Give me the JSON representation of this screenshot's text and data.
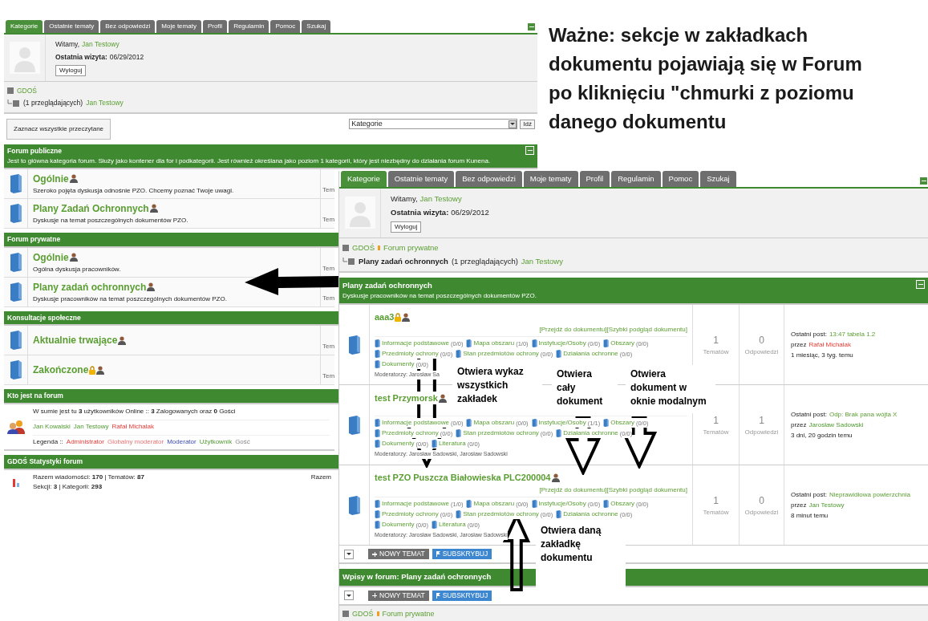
{
  "note": "Ważne: sekcje w zakładkach dokumentu pojawiają się w Forum po kliknięciu \"chmurki z poziomu danego dokumentu",
  "left_forum": {
    "tabs": [
      {
        "label": "Kategorie",
        "selected": true
      },
      {
        "label": "Ostatnie tematy",
        "selected": false
      },
      {
        "label": "Bez odpowiedzi",
        "selected": false
      },
      {
        "label": "Moje tematy",
        "selected": false
      },
      {
        "label": "Profil",
        "selected": false
      },
      {
        "label": "Regulamin",
        "selected": false
      },
      {
        "label": "Pomoc",
        "selected": false
      },
      {
        "label": "Szukaj",
        "selected": false
      }
    ],
    "user": {
      "greeting": "Witamy,",
      "name": "Jan Testowy",
      "last_visit_label": "Ostatnia wizyta:",
      "last_visit": "06/29/2012",
      "logout": "Wyloguj"
    },
    "breadcrumb": {
      "items": [
        "GDOŚ"
      ],
      "viewers": "(1 przeglądających)",
      "viewer_name": "Jan Testowy"
    },
    "mark_read": "Zaznacz wszystkie przeczytane",
    "category_select": {
      "value": "Kategorie"
    },
    "go": "Idź",
    "sections": [
      {
        "title": "Forum publiczne",
        "description": "Jest to główna kategoria forum. Służy jako kontener dla for i podkategorii. Jest również określana jako poziom 1 kategorii, który jest niezbędny do działania forum Kunena.",
        "rows": [
          {
            "title": "Ogólnie",
            "locked": false,
            "description": "Szeroko pojęta dyskusja odnośnie PZO. Chcemy poznać Twoje uwagi.",
            "stat": "Tem"
          },
          {
            "title": "Plany Zadań Ochronnych",
            "locked": false,
            "description": "Dyskusje na temat poszczególnych dokumentów PZO.",
            "stat": "Tem"
          }
        ]
      },
      {
        "title": "Forum prywatne",
        "rows": [
          {
            "title": "Ogólnie",
            "locked": false,
            "description": "Ogólna dyskusja pracowników.",
            "stat": "Tem"
          },
          {
            "title": "Plany zadań ochronnych",
            "locked": false,
            "description": "Dyskusje pracowników na temat poszczególnych dokumentów PZO.",
            "stat": "Tem"
          }
        ]
      },
      {
        "title": "Konsultacje społeczne",
        "rows": [
          {
            "title": "Aktualnie trwające",
            "locked": false,
            "stat": "Tem"
          },
          {
            "title": "Zakończone",
            "locked": true,
            "stat": "Tem"
          }
        ]
      }
    ],
    "who_online": {
      "title": "Kto jest na forum",
      "summary": "W sumie jest tu **3** użytkowników Online :: **3** Zalogowanych oraz **0** Gości",
      "users": [
        {
          "name": "Jan Kowalski",
          "kind": "user"
        },
        {
          "name": "Jan Testowy",
          "kind": "user"
        },
        {
          "name": "Rafał Michalak",
          "kind": "admin"
        }
      ],
      "legend_label": "Legenda ::",
      "legend": [
        {
          "name": "Administrator",
          "kind": "admin"
        },
        {
          "name": "Globalny moderator",
          "kind": "supermod"
        },
        {
          "name": "Moderator",
          "kind": "moderator"
        },
        {
          "name": "Użytkownik",
          "kind": "user"
        },
        {
          "name": "Gość",
          "kind": "guest"
        }
      ]
    },
    "stats": {
      "title": "GDOŚ Statystyki forum",
      "lines": [
        "Razem wiadomości: **170** | Tematów: **87**",
        "Sekcji: **3** | Kategorii: **293**"
      ],
      "side": "Razem"
    }
  },
  "right_forum": {
    "tabs": [
      {
        "label": "Kategorie",
        "selected": true
      },
      {
        "label": "Ostatnie tematy",
        "selected": false
      },
      {
        "label": "Bez odpowiedzi",
        "selected": false
      },
      {
        "label": "Moje tematy",
        "selected": false
      },
      {
        "label": "Profil",
        "selected": false
      },
      {
        "label": "Regulamin",
        "selected": false
      },
      {
        "label": "Pomoc",
        "selected": false
      },
      {
        "label": "Szukaj",
        "selected": false
      }
    ],
    "user": {
      "greeting": "Witamy,",
      "name": "Jan Testowy",
      "last_visit_label": "Ostatnia wizyta:",
      "last_visit": "06/29/2012",
      "logout": "Wyloguj"
    },
    "breadcrumb": {
      "items": [
        "GDOŚ",
        "Forum prywatne"
      ],
      "current": "Plany zadań ochronnych",
      "viewers": "(1 przeglądających)",
      "viewer_name": "Jan Testowy"
    },
    "section": {
      "title": "Plany zadań ochronnych",
      "description": "Dyskusje pracowników na temat poszczególnych dokumentów PZO."
    },
    "rows": [
      {
        "title": "aaa3",
        "locked": true,
        "links": "[Przejdź do dokumentu][Szybki podgląd dokumentu]",
        "tabs": [
          {
            "label": "Informacje podstawowe",
            "count": "(0/0)"
          },
          {
            "label": "Mapa obszaru",
            "count": "(1/0)"
          },
          {
            "label": "Instytucje/Osoby",
            "count": "(0/0)"
          },
          {
            "label": "Obszary",
            "count": "(0/0)"
          },
          {
            "label": "Przedmioty ochrony",
            "count": "(0/0)"
          },
          {
            "label": "Stan przedmiotów ochrony",
            "count": "(0/0)"
          },
          {
            "label": "Działania ochronne",
            "count": "(0/0)"
          },
          {
            "label": "Dokumenty",
            "count": "(0/0)"
          }
        ],
        "moderators": "Moderatorzy: Jarosław Sa",
        "topics": "1",
        "topics_label": "Tematów",
        "replies": "0",
        "replies_label": "Odpowiedzi",
        "last_post_label": "Ostatni post:",
        "last_post": "13:47 tabela 1.2",
        "by_label": "przez",
        "author": {
          "name": "Rafał Michalak",
          "kind": "admin"
        },
        "ago": "1 miesiąc, 3 tyg. temu"
      },
      {
        "title": "test Przymorsk",
        "locked": false,
        "tabs": [
          {
            "label": "Informacje podstawowe",
            "count": "(0/0)"
          },
          {
            "label": "Mapa obszaru",
            "count": "(0/0)"
          },
          {
            "label": "Instytucje/Osoby",
            "count": "(1/1)"
          },
          {
            "label": "Obszary",
            "count": "(0/0)"
          },
          {
            "label": "Przedmioty ochrony",
            "count": "(0/0)"
          },
          {
            "label": "Stan przedmiotów ochrony",
            "count": "(0/0)"
          },
          {
            "label": "Działania ochronne",
            "count": "(0/0)"
          },
          {
            "label": "Dokumenty",
            "count": "(0/0)"
          },
          {
            "label": "Literatura",
            "count": "(0/0)"
          }
        ],
        "moderators": "Moderatorzy: Jarosław Sadowski, Jarosław Sadowski",
        "topics": "1",
        "topics_label": "Tematów",
        "replies": "1",
        "replies_label": "Odpowiedzi",
        "last_post_label": "Ostatni post:",
        "last_post": "Odp: Brak pana wójta X",
        "by_label": "przez",
        "author": {
          "name": "Jarosław Sadowski",
          "kind": "user"
        },
        "ago": "3 dni, 20 godzin temu"
      },
      {
        "title": "test PZO Puszcza Białowieska PLC200004",
        "locked": false,
        "links": "[Przejdź do dokumentu][Szybki podgląd dokumentu]",
        "tabs": [
          {
            "label": "Informacje podstawowe",
            "count": "(1/0)"
          },
          {
            "label": "Mapa obszaru",
            "count": "(0/0)"
          },
          {
            "label": "Instytucje/Osoby",
            "count": "(0/0)"
          },
          {
            "label": "Obszary",
            "count": "(0/0)"
          },
          {
            "label": "Przedmioty ochrony",
            "count": "(0/0)"
          },
          {
            "label": "Stan przedmiotów ochrony",
            "count": "(0/0)"
          },
          {
            "label": "Działania ochronne",
            "count": "(0/0)"
          },
          {
            "label": "Dokumenty",
            "count": "(0/0)"
          },
          {
            "label": "Literatura",
            "count": "(0/0)"
          }
        ],
        "moderators": "Moderatorzy: Jarosław Sadowski, Jarosław Sadowski",
        "topics": "1",
        "topics_label": "Tematów",
        "replies": "0",
        "replies_label": "Odpowiedzi",
        "last_post_label": "Ostatni post:",
        "last_post": "Nieprawidłowa powierzchnia",
        "by_label": "przez",
        "author": {
          "name": "Jan Testowy",
          "kind": "user"
        },
        "ago": "8 minut temu"
      }
    ],
    "actions_top": {
      "new_topic": "NOWY TEMAT",
      "subscribe": "SUBSKRYBUJ"
    },
    "posts_title": "Wpisy w forum: Plany zadań ochronnych",
    "actions_bottom": {
      "new_topic": "NOWY TEMAT",
      "subscribe": "SUBSKRYBUJ"
    },
    "bottom_breadcrumb": [
      "GDOŚ",
      "Forum prywatne"
    ]
  },
  "callouts": [
    {
      "text": "Otwiera wykaz wszystkich zakładek"
    },
    {
      "text": "Otwiera cały dokument"
    },
    {
      "text": "Otwiera dokument w oknie modalnym"
    },
    {
      "text": "Otwiera daną zakładkę dokumentu"
    }
  ]
}
